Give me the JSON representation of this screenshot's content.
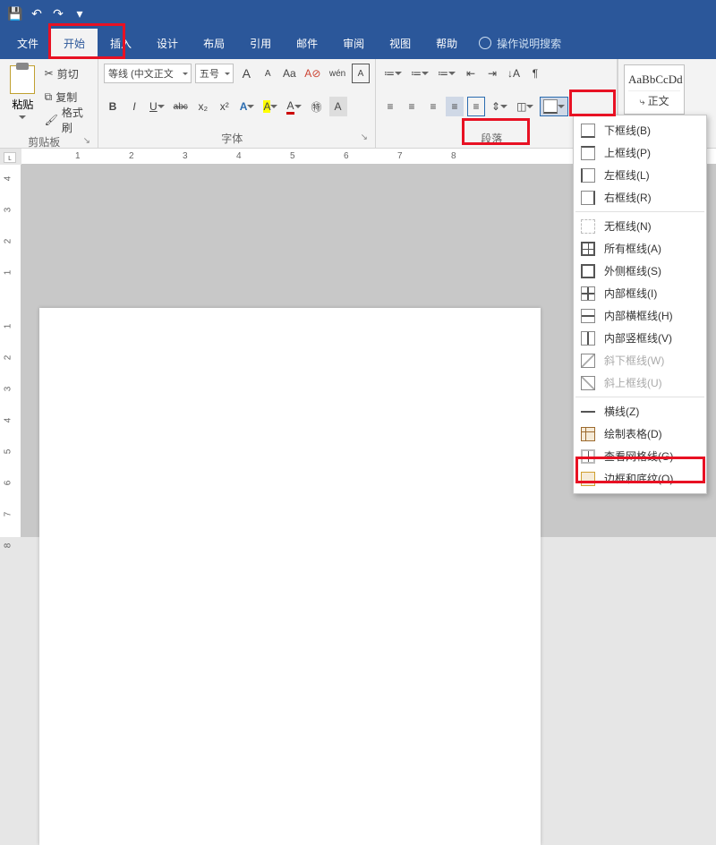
{
  "titlebar": {
    "save": "💾",
    "undo": "↶",
    "redo": "↷",
    "more": "▾"
  },
  "tabs": {
    "file": "文件",
    "home": "开始",
    "insert": "插入",
    "design": "设计",
    "layout": "布局",
    "references": "引用",
    "mailings": "邮件",
    "review": "审阅",
    "view": "视图",
    "help": "帮助",
    "tellme": "操作说明搜索"
  },
  "clipboard": {
    "paste": "粘贴",
    "cut": "剪切",
    "copy": "复制",
    "fmt": "格式刷",
    "label": "剪贴板"
  },
  "font": {
    "name": "等线 (中文正文",
    "size": "五号",
    "grow": "A",
    "shrink": "A",
    "changecase": "Aa",
    "clear": "A",
    "pinyin": "wén",
    "charborder": "A",
    "bold": "B",
    "italic": "I",
    "underline": "U",
    "strike": "abc",
    "sub": "x₂",
    "sup": "x²",
    "texteffect": "A",
    "highlight": "A",
    "color": "A",
    "circle": "㊕",
    "char2": "A",
    "label": "字体"
  },
  "para": {
    "bullets": "≔",
    "numbering": "≔",
    "multilevel": "≔",
    "decrease": "⇤",
    "increase": "⇥",
    "sort": "↓A",
    "marks": "¶",
    "alignL": "≡",
    "alignC": "≡",
    "alignR": "≡",
    "justify": "≡",
    "dist": "≡",
    "spacing": "⇕",
    "shading": "◫",
    "borders": "⊞",
    "label": "段落"
  },
  "styles": {
    "preview": "AaBbCcDd",
    "name": "正文"
  },
  "borders_menu": {
    "bottom": "下框线(B)",
    "top": "上框线(P)",
    "left": "左框线(L)",
    "right": "右框线(R)",
    "none": "无框线(N)",
    "all": "所有框线(A)",
    "outside": "外侧框线(S)",
    "inside": "内部框线(I)",
    "insideH": "内部横框线(H)",
    "insideV": "内部竖框线(V)",
    "diagDown": "斜下框线(W)",
    "diagUp": "斜上框线(U)",
    "hline": "横线(Z)",
    "draw": "绘制表格(D)",
    "viewgrid": "查看网格线(G)",
    "dialog": "边框和底纹(O)..."
  },
  "ruler": {
    "corner": "ʟ",
    "h": [
      "1",
      "2",
      "3",
      "4",
      "5",
      "6",
      "7",
      "8"
    ],
    "v": [
      "4",
      "3",
      "2",
      "1",
      "1",
      "2",
      "3",
      "4",
      "5",
      "6",
      "7",
      "8"
    ]
  }
}
